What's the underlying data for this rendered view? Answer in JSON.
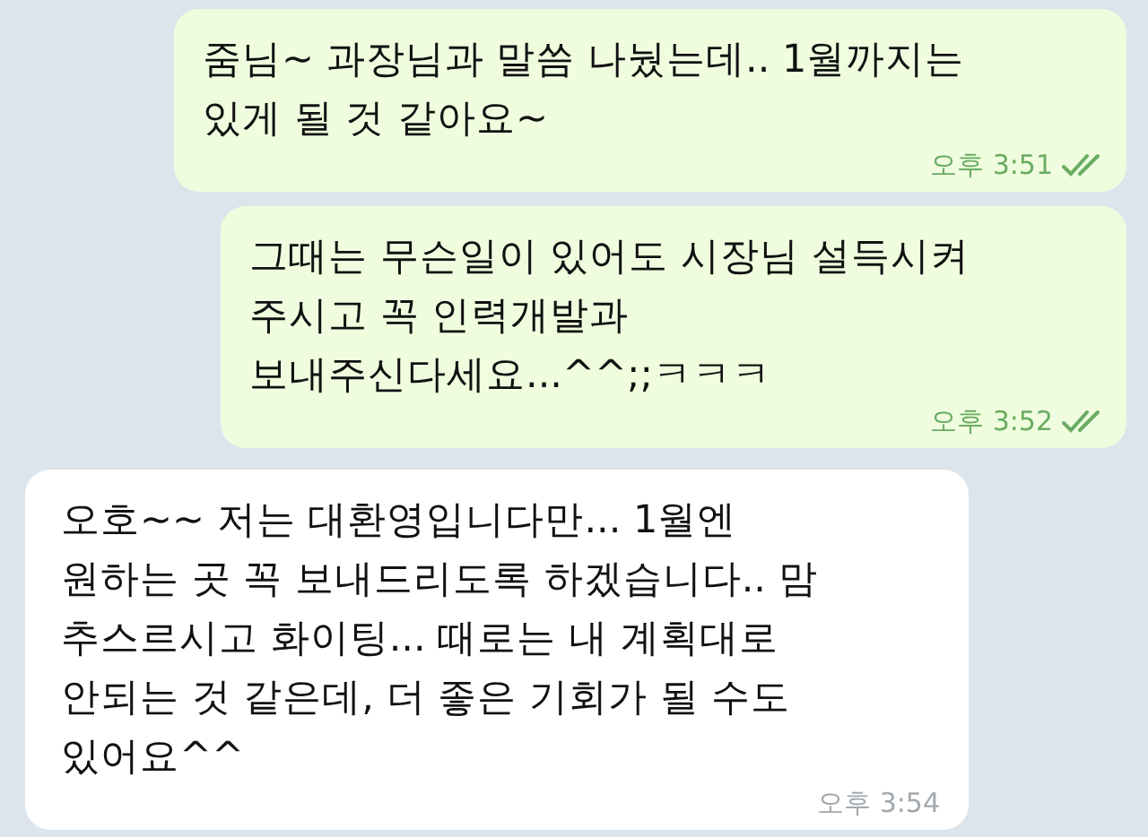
{
  "messages": [
    {
      "outgoing": true,
      "text": "줌님~ 과장님과 말씀 나눴는데.. 1월까지는\n있게 될 것 같아요~",
      "time": "오후 3:51",
      "read": true
    },
    {
      "outgoing": true,
      "text": "그때는 무슨일이 있어도 시장님 설득시켜\n주시고 꼭 인력개발과\n보내주신다세요...^^;;ㅋㅋㅋ",
      "time": "오후 3:52",
      "read": true
    },
    {
      "outgoing": false,
      "text": "오호~~ 저는 대환영입니다만... 1월엔\n원하는 곳 꼭 보내드리도록 하겠습니다.. 맘\n추스르시고 화이팅... 때로는 내 계획대로\n안되는 것 같은데, 더 좋은 기회가 될 수도\n있어요^^",
      "time": "오후 3:54"
    }
  ]
}
